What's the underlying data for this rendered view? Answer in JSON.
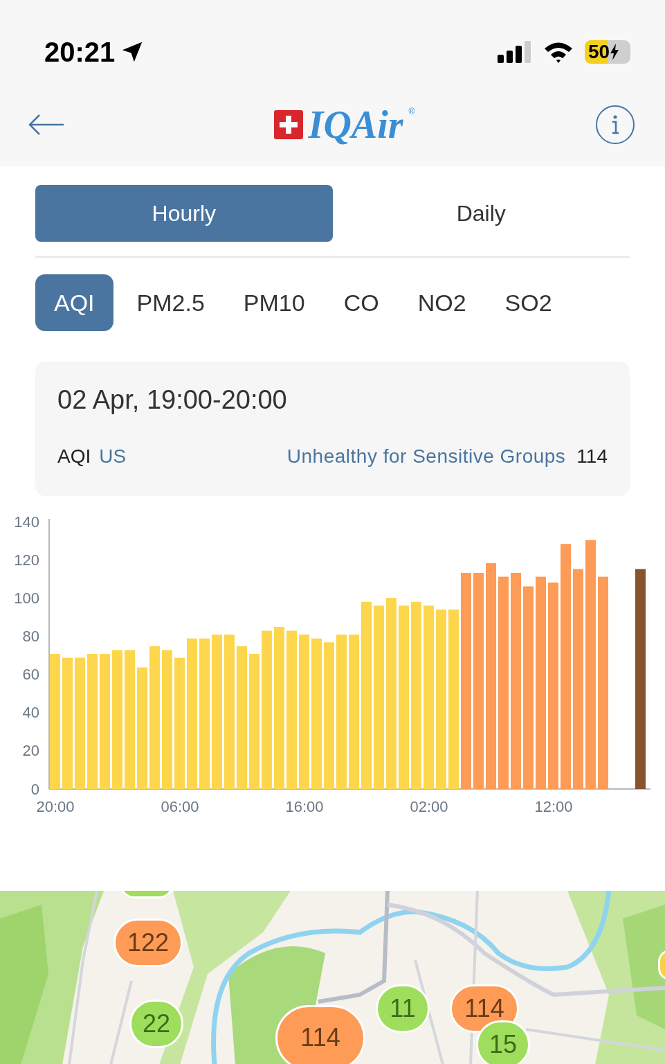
{
  "status_bar": {
    "time": "20:21",
    "battery": "50"
  },
  "header": {
    "logo_text": "IQAir",
    "logo_mark": "®"
  },
  "period_tabs": [
    {
      "label": "Hourly",
      "selected": true
    },
    {
      "label": "Daily",
      "selected": false
    }
  ],
  "pollutant_tabs": [
    {
      "label": "AQI",
      "selected": true
    },
    {
      "label": "PM2.5",
      "selected": false
    },
    {
      "label": "PM10",
      "selected": false
    },
    {
      "label": "CO",
      "selected": false
    },
    {
      "label": "NO2",
      "selected": false
    },
    {
      "label": "SO2",
      "selected": false
    }
  ],
  "reading": {
    "period": "02 Apr, 19:00-20:00",
    "index": "AQI",
    "standard": "US",
    "category": "Unhealthy for Sensitive Groups",
    "value": "114"
  },
  "chart_data": {
    "type": "bar",
    "categories": [
      "20:00",
      null,
      null,
      null,
      null,
      null,
      null,
      null,
      null,
      null,
      "06:00",
      null,
      null,
      null,
      null,
      null,
      null,
      null,
      null,
      null,
      "16:00",
      null,
      null,
      null,
      null,
      null,
      null,
      null,
      null,
      null,
      "02:00",
      null,
      null,
      null,
      null,
      null,
      null,
      null,
      null,
      null,
      "12:00",
      null,
      null,
      null,
      null,
      null,
      null,
      null
    ],
    "series": [
      {
        "color": "#fdd64b",
        "values": [
          70,
          68,
          68,
          70,
          70,
          72,
          72,
          63,
          74,
          72,
          68,
          78,
          78,
          80,
          80,
          74,
          70,
          82,
          84,
          82,
          80,
          78,
          76,
          80,
          80,
          97,
          95,
          99,
          95,
          97,
          95,
          93,
          93,
          null,
          null,
          null,
          null,
          null,
          null,
          null,
          null,
          null,
          null,
          null,
          null,
          null,
          null,
          null
        ]
      },
      {
        "color": "#fe9b57",
        "values": [
          null,
          null,
          null,
          null,
          null,
          null,
          null,
          null,
          null,
          null,
          null,
          null,
          null,
          null,
          null,
          null,
          null,
          null,
          null,
          null,
          null,
          null,
          null,
          null,
          null,
          null,
          null,
          null,
          null,
          null,
          null,
          null,
          null,
          112,
          112,
          117,
          110,
          112,
          105,
          110,
          107,
          127,
          114,
          129,
          110,
          null,
          null,
          null
        ]
      },
      {
        "color": "#8a5330",
        "values": [
          null,
          null,
          null,
          null,
          null,
          null,
          null,
          null,
          null,
          null,
          null,
          null,
          null,
          null,
          null,
          null,
          null,
          null,
          null,
          null,
          null,
          null,
          null,
          null,
          null,
          null,
          null,
          null,
          null,
          null,
          null,
          null,
          null,
          null,
          null,
          null,
          null,
          null,
          null,
          null,
          null,
          null,
          null,
          null,
          null,
          null,
          null,
          114
        ]
      }
    ],
    "ylim": [
      0,
      140
    ],
    "yticks": [
      0,
      20,
      40,
      60,
      80,
      100,
      120,
      140
    ]
  },
  "map": {
    "kind": "picture",
    "markers": [
      {
        "color": "#9ede5c"
      },
      {
        "value": "122",
        "color": "#fe9b57"
      },
      {
        "value": "22",
        "color": "#9ede5c"
      },
      {
        "value": "114",
        "color": "#fe9b57"
      },
      {
        "value": "11",
        "color": "#9ede5c"
      },
      {
        "value": "114",
        "color": "#fe9b57"
      },
      {
        "value": "15",
        "color": "#9ede5c"
      },
      {
        "color": "#f6d148"
      }
    ]
  }
}
